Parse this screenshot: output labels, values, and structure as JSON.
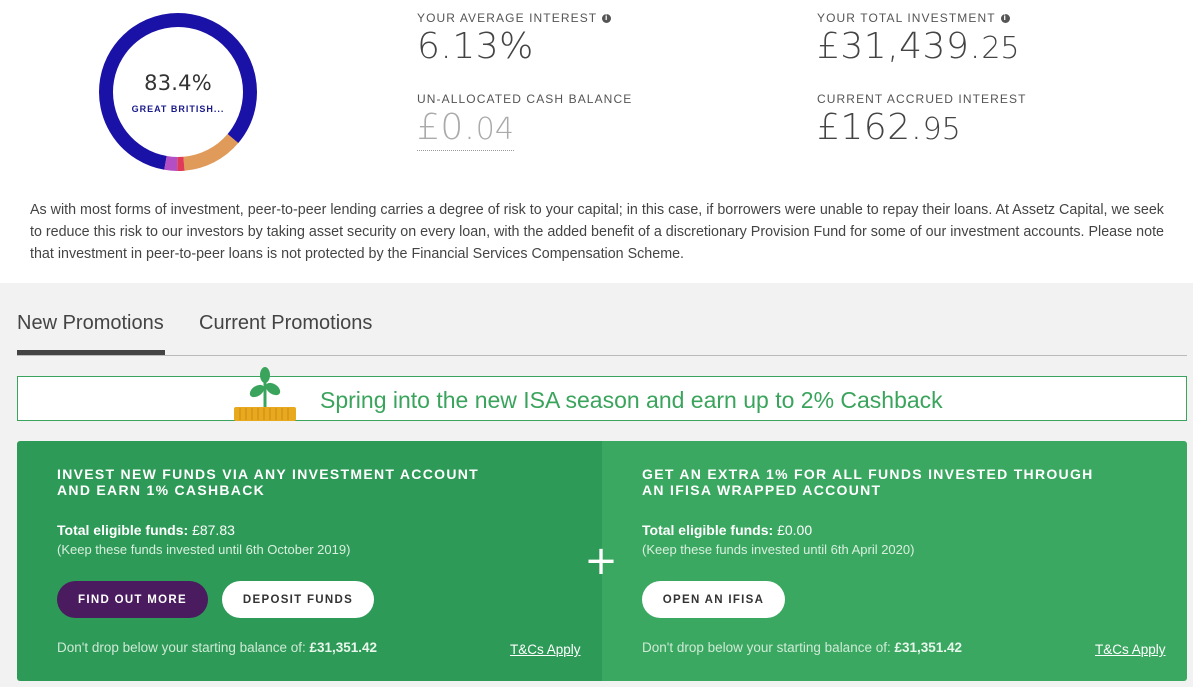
{
  "portfolio": {
    "donut_percent": "83.4%",
    "donut_label": "GREAT BRITISH...",
    "segments": [
      {
        "fraction": 0.834,
        "color": "#1a12a6"
      },
      {
        "fraction": 0.125,
        "color": "#e09a5a"
      },
      {
        "fraction": 0.015,
        "color": "#e03a5a"
      },
      {
        "fraction": 0.026,
        "color": "#b34ec4"
      }
    ]
  },
  "stats": {
    "avg_interest_label": "YOUR AVERAGE INTEREST",
    "avg_interest_value": "6.13%",
    "total_investment_label": "YOUR TOTAL INVESTMENT",
    "total_investment_main": "£31,439.",
    "total_investment_dec": "25",
    "unallocated_label": "UN-ALLOCATED CASH BALANCE",
    "unallocated_main": "£0.",
    "unallocated_dec": "04",
    "accrued_label": "CURRENT ACCRUED INTEREST",
    "accrued_main": "£162.",
    "accrued_dec": "95"
  },
  "risk_text": "As with most forms of investment, peer-to-peer lending carries a degree of risk to your capital; in this case, if borrowers were unable to repay their loans. At Assetz Capital, we seek to reduce this risk to our investors by taking asset security on every loan, with the added benefit of a discretionary Provision Fund for some of our investment accounts. Please note that investment in peer-to-peer loans is not protected by the Financial Services Compensation Scheme.",
  "tabs": [
    {
      "label": "New Promotions",
      "active": true
    },
    {
      "label": "Current Promotions",
      "active": false
    }
  ],
  "banner": {
    "text": "Spring into the new ISA season and earn up to 2% Cashback"
  },
  "cards": {
    "left": {
      "title": "INVEST NEW FUNDS VIA ANY INVESTMENT ACCOUNT AND EARN 1% CASHBACK",
      "eligible_label": "Total eligible funds:",
      "eligible_value": "£87.83",
      "keep_note": "(Keep these funds invested until 6th October 2019)",
      "btn_primary": "FIND OUT MORE",
      "btn_secondary": "DEPOSIT FUNDS",
      "foot_text": "Don't drop below your starting balance of:",
      "foot_value": "£31,351.42",
      "tcs": "T&Cs Apply"
    },
    "right": {
      "title": "GET AN EXTRA 1% FOR ALL FUNDS INVESTED THROUGH AN IFISA WRAPPED ACCOUNT",
      "eligible_label": "Total eligible funds:",
      "eligible_value": "£0.00",
      "keep_note": "(Keep these funds invested until 6th April 2020)",
      "btn_secondary": "OPEN AN IFISA",
      "foot_text": "Don't drop below your starting balance of:",
      "foot_value": "£31,351.42",
      "tcs": "T&Cs Apply"
    },
    "plus_symbol": "+"
  }
}
